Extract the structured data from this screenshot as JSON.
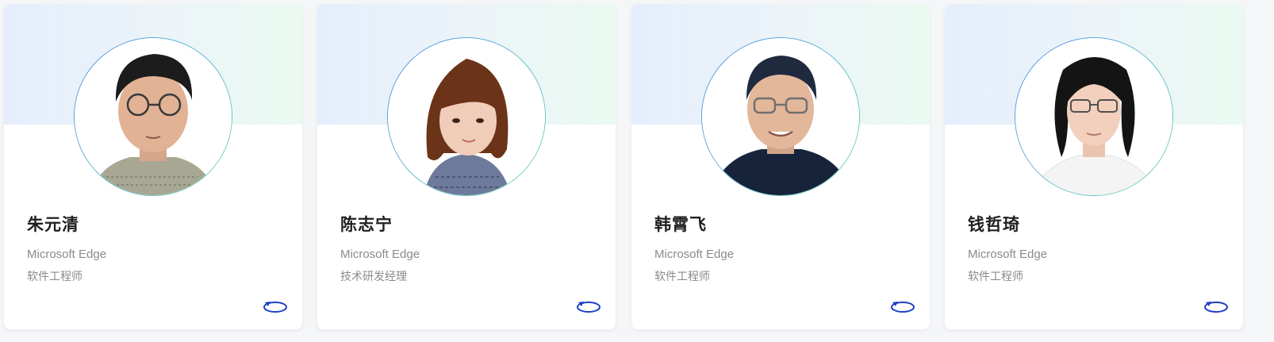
{
  "cards": [
    {
      "name": "朱元清",
      "company": "Microsoft Edge",
      "role": "软件工程师",
      "avatar_icon": "person-photo-icon",
      "flip_icon": "rotate-icon"
    },
    {
      "name": "陈志宁",
      "company": "Microsoft Edge",
      "role": "技术研发经理",
      "avatar_icon": "person-photo-icon",
      "flip_icon": "rotate-icon"
    },
    {
      "name": "韩霄飞",
      "company": "Microsoft Edge",
      "role": "软件工程师",
      "avatar_icon": "person-photo-icon",
      "flip_icon": "rotate-icon"
    },
    {
      "name": "钱哲琦",
      "company": "Microsoft Edge",
      "role": "软件工程师",
      "avatar_icon": "person-photo-icon",
      "flip_icon": "rotate-icon"
    }
  ],
  "colors": {
    "accent": "#1d3fc6",
    "banner_start": "#e5eefc",
    "banner_end": "#eafaf1",
    "ring_start": "#4a8fe8",
    "ring_end": "#6fd9b4"
  }
}
